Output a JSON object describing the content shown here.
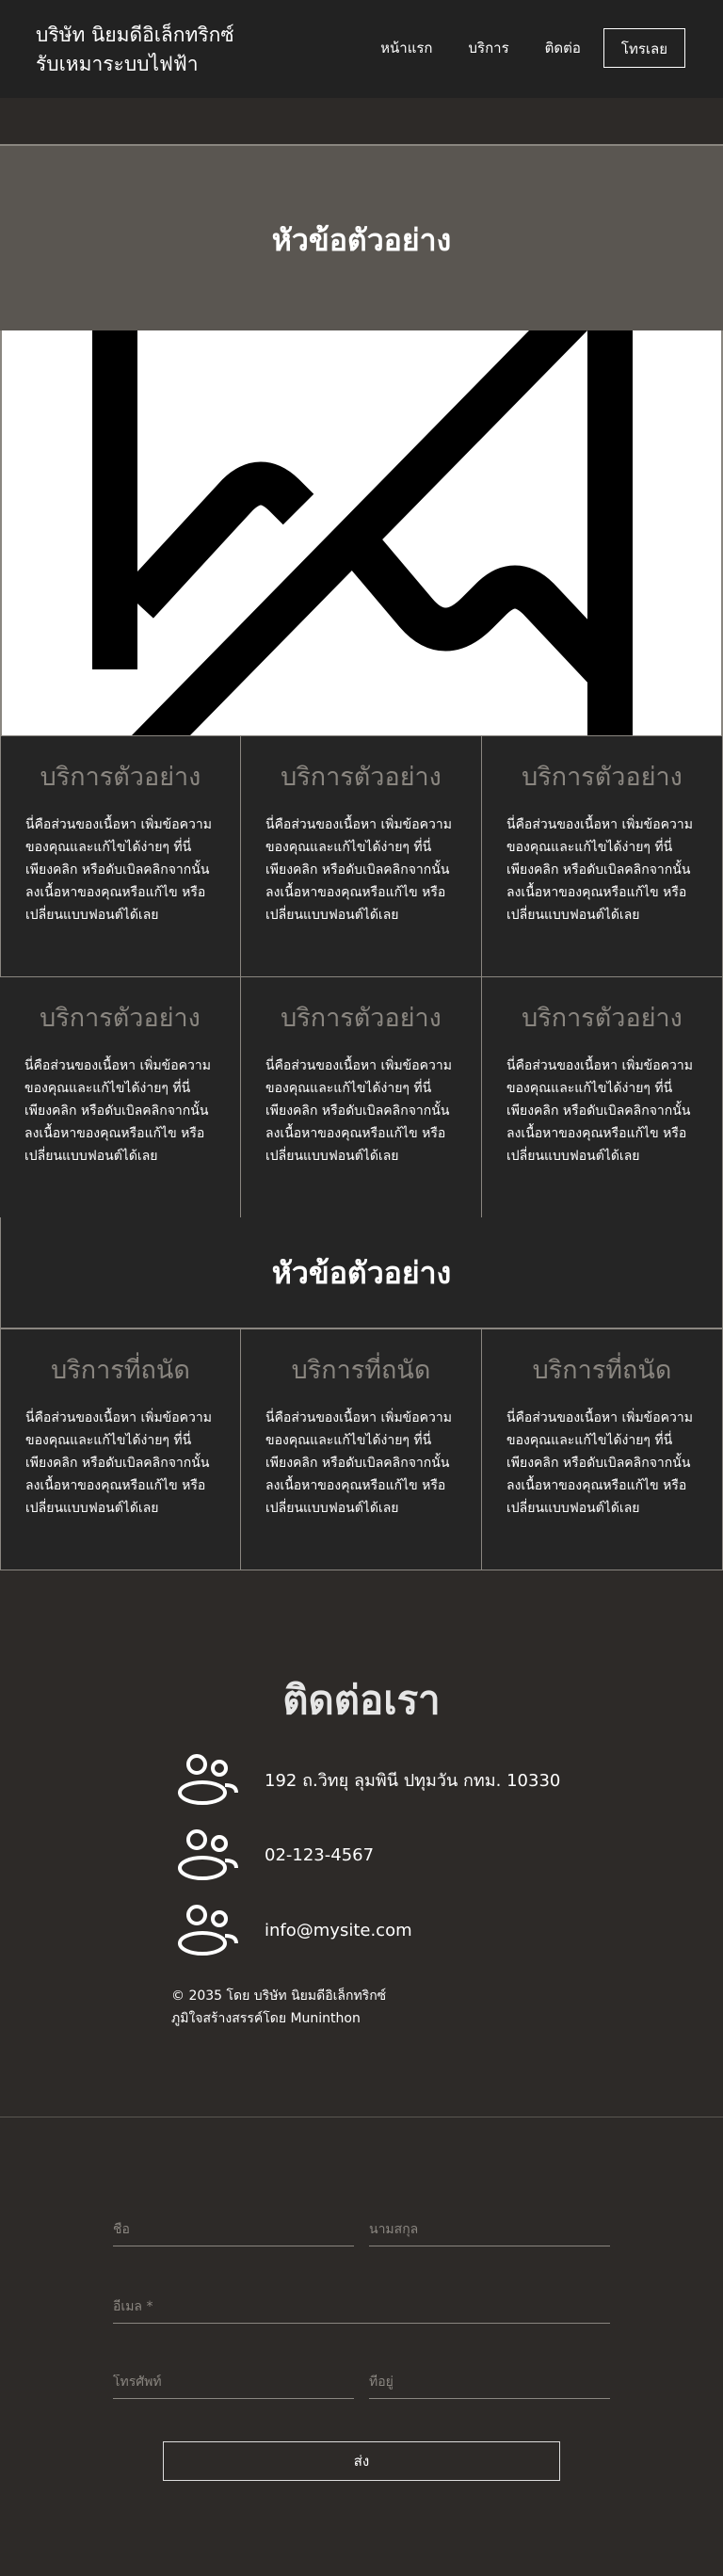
{
  "header": {
    "brand_line1": "บริษัท นิยมดีอิเล็กทริกซ์",
    "brand_line2": "รับเหมาระบบไฟฟ้า",
    "nav": [
      "หน้าแรก",
      "บริการ",
      "ติดต่อ"
    ],
    "call_button": "โทรเลย"
  },
  "hero": {
    "title": "หัวข้อตัวอย่าง"
  },
  "services_a": [
    {
      "title": "บริการตัวอย่าง",
      "text": "นี่คือส่วนของเนื้อหา เพิ่มข้อความของคุณและแก้ไขได้ง่ายๆ ที่นี่ เพียงคลิก หรือดับเบิลคลิกจากนั้นลงเนื้อหาของคุณหรือแก้ไข หรือเปลี่ยนแบบฟอนต์ได้เลย"
    },
    {
      "title": "บริการตัวอย่าง",
      "text": "นี่คือส่วนของเนื้อหา เพิ่มข้อความของคุณและแก้ไขได้ง่ายๆ ที่นี่ เพียงคลิก หรือดับเบิลคลิกจากนั้นลงเนื้อหาของคุณหรือแก้ไข หรือเปลี่ยนแบบฟอนต์ได้เลย"
    },
    {
      "title": "บริการตัวอย่าง",
      "text": "นี่คือส่วนของเนื้อหา เพิ่มข้อความของคุณและแก้ไขได้ง่ายๆ ที่นี่ เพียงคลิก หรือดับเบิลคลิกจากนั้นลงเนื้อหาของคุณหรือแก้ไข หรือเปลี่ยนแบบฟอนต์ได้เลย"
    },
    {
      "title": "บริการตัวอย่าง",
      "text": "นี่คือส่วนของเนื้อหา เพิ่มข้อความของคุณและแก้ไขได้ง่ายๆ ที่นี่ เพียงคลิก หรือดับเบิลคลิกจากนั้นลงเนื้อหาของคุณหรือแก้ไข หรือเปลี่ยนแบบฟอนต์ได้เลย"
    },
    {
      "title": "บริการตัวอย่าง",
      "text": "นี่คือส่วนของเนื้อหา เพิ่มข้อความของคุณและแก้ไขได้ง่ายๆ ที่นี่ เพียงคลิก หรือดับเบิลคลิกจากนั้นลงเนื้อหาของคุณหรือแก้ไข หรือเปลี่ยนแบบฟอนต์ได้เลย"
    },
    {
      "title": "บริการตัวอย่าง",
      "text": "นี่คือส่วนของเนื้อหา เพิ่มข้อความของคุณและแก้ไขได้ง่ายๆ ที่นี่ เพียงคลิก หรือดับเบิลคลิกจากนั้นลงเนื้อหาของคุณหรือแก้ไข หรือเปลี่ยนแบบฟอนต์ได้เลย"
    }
  ],
  "section2_title": "หัวข้อตัวอย่าง",
  "services_b": [
    {
      "title": "บริการที่ถนัด",
      "text": "นี่คือส่วนของเนื้อหา เพิ่มข้อความของคุณและแก้ไขได้ง่ายๆ ที่นี่ เพียงคลิก หรือดับเบิลคลิกจากนั้นลงเนื้อหาของคุณหรือแก้ไข หรือเปลี่ยนแบบฟอนต์ได้เลย"
    },
    {
      "title": "บริการที่ถนัด",
      "text": "นี่คือส่วนของเนื้อหา เพิ่มข้อความของคุณและแก้ไขได้ง่ายๆ ที่นี่ เพียงคลิก หรือดับเบิลคลิกจากนั้นลงเนื้อหาของคุณหรือแก้ไข หรือเปลี่ยนแบบฟอนต์ได้เลย"
    },
    {
      "title": "บริการที่ถนัด",
      "text": "นี่คือส่วนของเนื้อหา เพิ่มข้อความของคุณและแก้ไขได้ง่ายๆ ที่นี่ เพียงคลิก หรือดับเบิลคลิกจากนั้นลงเนื้อหาของคุณหรือแก้ไข หรือเปลี่ยนแบบฟอนต์ได้เลย"
    }
  ],
  "contact": {
    "title": "ติดต่อเรา",
    "address": "192 ถ.วิทยุ ลุมพินี ปทุมวัน กทม. 10330",
    "phone": "02-123-4567",
    "email": "info@mysite.com",
    "icon": "people-icon",
    "footnote_1": "© 2035 โดย บริษัท นิยมดีอิเล็กทริกซ์",
    "footnote_2": "ภูมิใจสร้างสรรค์โดย Muninthon"
  },
  "form": {
    "first_name": "ชื่อ",
    "last_name": "นามสกุล",
    "email": "อีเมล *",
    "phone": "โทรศัพท์",
    "address": "ที่อยู่",
    "submit": "ส่ง"
  },
  "colors": {
    "header_bg": "#222222",
    "hero_bg": "#5a5651",
    "card_bg": "#252525",
    "page_bg": "#2d2a28",
    "muted": "#8a8680"
  }
}
